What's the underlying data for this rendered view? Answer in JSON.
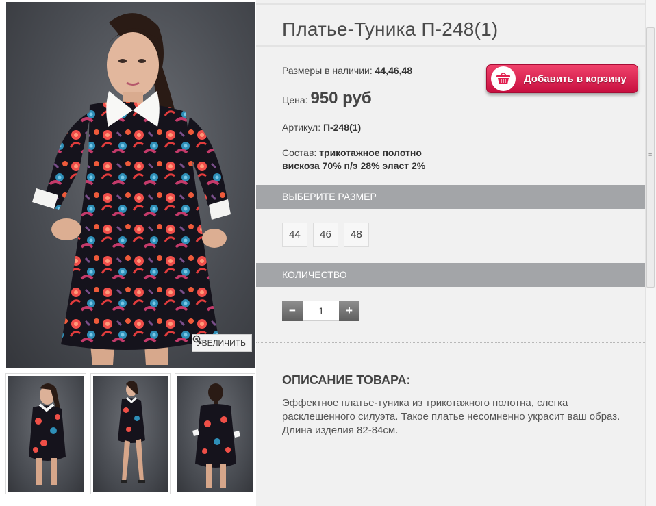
{
  "product": {
    "title": "Платье-Туника П-248(1)",
    "sizes_label": "Размеры в наличии:",
    "sizes_value": "44,46,48",
    "price_label": "Цена:",
    "price_value": "950 руб",
    "article_label": "Артикул:",
    "article_value": "П-248(1)",
    "composition_label": "Состав:",
    "composition_line1": "трикотажное полотно",
    "composition_line2": "вискоза 70% п/э 28% эласт 2%"
  },
  "cart_button": {
    "label": "Добавить в корзину",
    "icon": "basket-icon",
    "color": "#e11f4f"
  },
  "gallery": {
    "zoom_label": "УВЕЛИЧИТЬ",
    "zoom_icon": "magnifier-plus-icon",
    "thumbnails": 3
  },
  "size_section": {
    "header": "ВЫБЕРИТЕ РАЗМЕР",
    "options": [
      "44",
      "46",
      "48"
    ]
  },
  "quantity_section": {
    "header": "КОЛИЧЕСТВО",
    "minus": "−",
    "plus": "+",
    "value": "1"
  },
  "description": {
    "title": "ОПИСАНИЕ ТОВАРА:",
    "text": "Эффектное платье-туника из трикотажного полотна, слегка расклешенного силуэта. Такое платье несомненно украсит ваш образ. Длина изделия 82-84см."
  },
  "colors": {
    "section_bar": "#a3a5a8",
    "panel_bg": "#f1f1f1",
    "cart_red": "#e11f4f"
  }
}
